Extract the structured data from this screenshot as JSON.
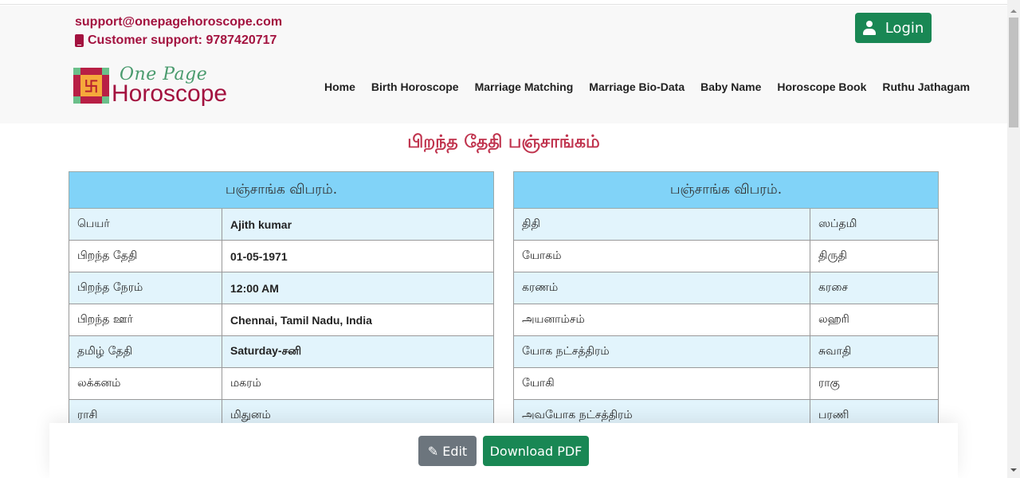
{
  "header": {
    "support_email": "support@onepagehoroscope.com",
    "support_phone": "Customer support: 9787420717",
    "login_label": "Login",
    "logo": {
      "line1": "One Page",
      "line2": "Horoscope",
      "symbol": "卐"
    },
    "nav": [
      {
        "label": "Home"
      },
      {
        "label": "Birth Horoscope"
      },
      {
        "label": "Marriage Matching"
      },
      {
        "label": "Marriage Bio-Data"
      },
      {
        "label": "Baby Name"
      },
      {
        "label": "Horoscope Book"
      },
      {
        "label": "Ruthu Jathagam"
      }
    ]
  },
  "page_title": "பிறந்த தேதி பஞ்சாங்கம்",
  "left_table": {
    "heading": "பஞ்சாங்க விபரம்.",
    "rows": [
      {
        "label": "பெயர்",
        "value": "Ajith kumar"
      },
      {
        "label": "பிறந்த தேதி",
        "value": "01-05-1971"
      },
      {
        "label": "பிறந்த நேரம்",
        "value": "12:00 AM"
      },
      {
        "label": "பிறந்த ஊர்",
        "value": "Chennai, Tamil Nadu, India"
      },
      {
        "label": "தமிழ் தேதி",
        "value": "Saturday-சனி"
      },
      {
        "label": "லக்கனம்",
        "value": "மகரம்"
      },
      {
        "label": "ராசி",
        "value": "மிதுனம்"
      }
    ]
  },
  "right_table": {
    "heading": "பஞ்சாங்க விபரம்.",
    "rows": [
      {
        "label": "திதி",
        "value": "ஸப்தமி"
      },
      {
        "label": "யோகம்",
        "value": "திருதி"
      },
      {
        "label": "கரணம்",
        "value": "கரசை"
      },
      {
        "label": "அயனாம்சம்",
        "value": "லஹரி"
      },
      {
        "label": "யோக நட்சத்திரம்",
        "value": "சுவாதி"
      },
      {
        "label": "யோகி",
        "value": "ராகு"
      },
      {
        "label": "அவயோக நட்சத்திரம்",
        "value": "பரணி"
      }
    ]
  },
  "footer": {
    "edit_label": "Edit",
    "download_label": "Download PDF"
  },
  "colors": {
    "brand": "#a3123f",
    "primary_green": "#198754",
    "table_header": "#81d3f8",
    "row_alt": "#e2f4fc"
  }
}
